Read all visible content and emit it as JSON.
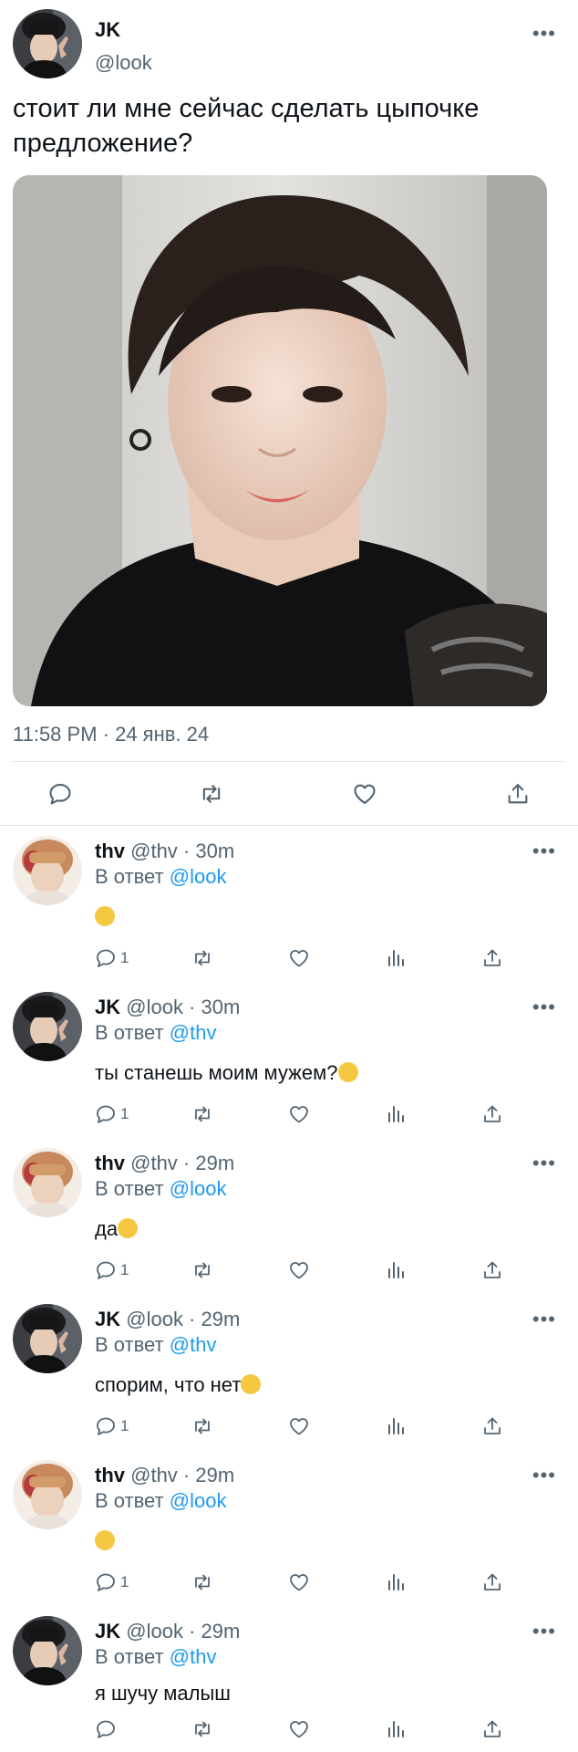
{
  "main": {
    "name": "JK",
    "handle": "@look",
    "text": "стоит ли мне сейчас сделать цыпочке предложение?",
    "timestamp": "11:58 PM · 24 янв. 24",
    "more": "•••"
  },
  "replies": [
    {
      "name": "thv",
      "meta": "@thv · 30m",
      "reply_prefix": "В ответ",
      "mention": "@look",
      "text": "",
      "emoji": "flushed",
      "reply_count": "1"
    },
    {
      "name": "JK",
      "meta": "@look · 30m",
      "reply_prefix": "В ответ",
      "mention": "@thv",
      "text": "ты станешь моим мужем?",
      "emoji": "shushing",
      "reply_count": "1"
    },
    {
      "name": "thv",
      "meta": "@thv · 29m",
      "reply_prefix": "В ответ",
      "mention": "@look",
      "text": "да",
      "emoji": "pleading",
      "reply_count": "1"
    },
    {
      "name": "JK",
      "meta": "@look · 29m",
      "reply_prefix": "В ответ",
      "mention": "@thv",
      "text": "спорим, что нет",
      "emoji": "tears-of-joy",
      "reply_count": "1"
    },
    {
      "name": "thv",
      "meta": "@thv · 29m",
      "reply_prefix": "В ответ",
      "mention": "@look",
      "text": "",
      "emoji": "crying",
      "reply_count": "1"
    },
    {
      "name": "JK",
      "meta": "@look · 29m",
      "reply_prefix": "В ответ",
      "mention": "@thv",
      "text": "я шучу малыш",
      "emoji": "",
      "reply_count": ""
    }
  ],
  "colors": {
    "accent": "#1d9bf0",
    "secondary": "#536471",
    "text": "#0f1419",
    "divider": "#e1e5e8"
  },
  "icons": [
    "reply-icon",
    "retweet-icon",
    "like-icon",
    "share-icon",
    "stats-icon",
    "more-icon"
  ]
}
